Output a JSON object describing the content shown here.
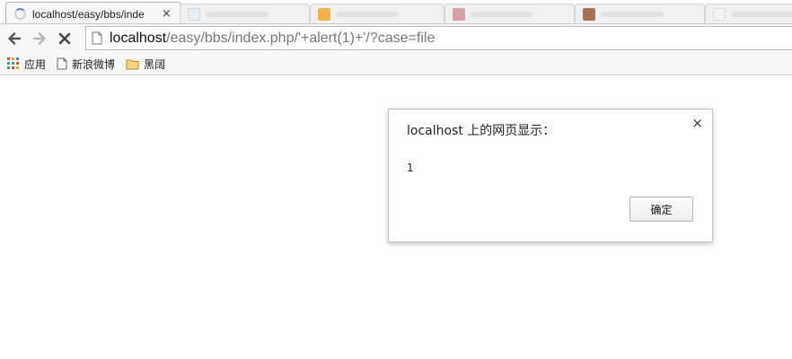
{
  "tabs": {
    "active": {
      "title": "localhost/easy/bbs/inde",
      "close": "×"
    }
  },
  "toolbar": {
    "back_icon": "arrow-left-icon",
    "forward_icon": "arrow-right-icon",
    "stop_icon": "stop-x-icon"
  },
  "omnibox": {
    "host": "localhost",
    "path": "/easy/bbs/index.php/'+alert(1)+'/?case=file"
  },
  "bookmarks": {
    "items": [
      {
        "label": "应用",
        "icon": "apps-grid-icon"
      },
      {
        "label": "新浪微博",
        "icon": "page-icon"
      },
      {
        "label": "黑阔",
        "icon": "folder-icon"
      }
    ]
  },
  "dialog": {
    "title": "localhost 上的网页显示：",
    "message": "1",
    "ok_label": "确定",
    "close": "×"
  },
  "colors": {
    "accent": "#5a8ad6",
    "tabstrip_bg": "#fbfbfb",
    "toolbar_bg": "#f6f6f6"
  }
}
